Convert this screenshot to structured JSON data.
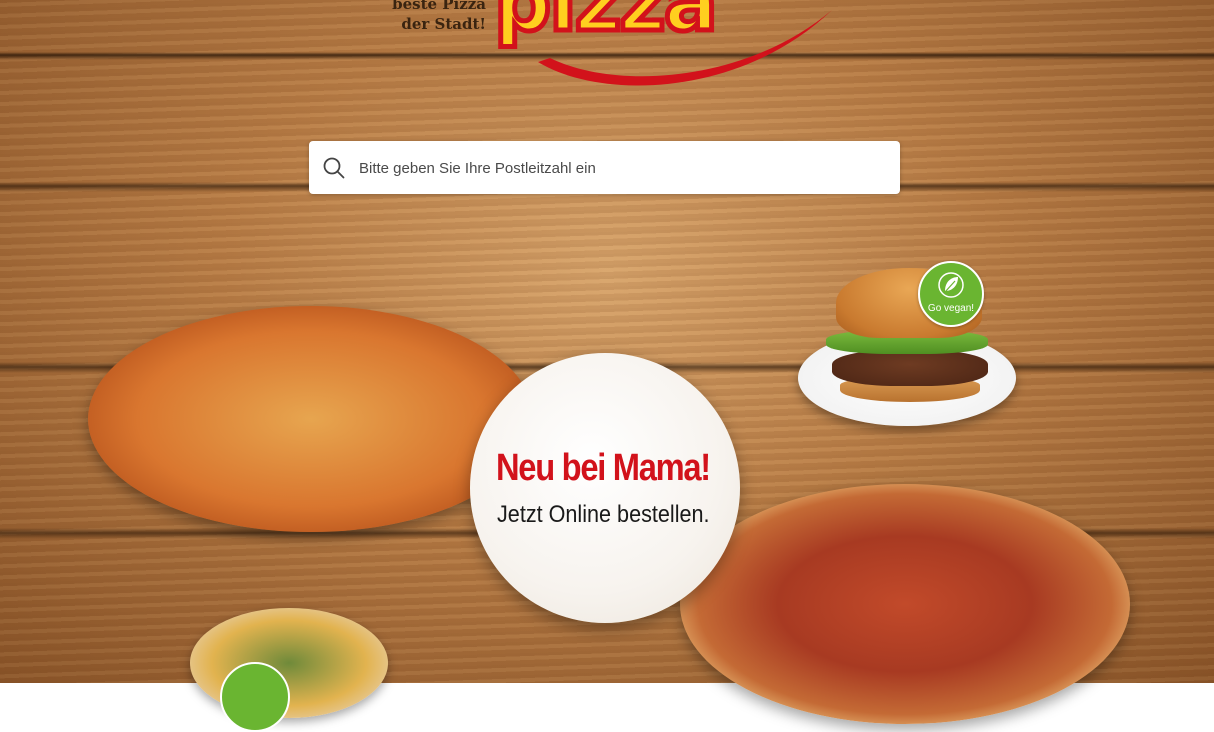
{
  "logo": {
    "tagline_line1": "beste Pizza",
    "tagline_line2": "der Stadt!",
    "wordmark": "pizza",
    "colors": {
      "fill": "#ffcf1f",
      "stroke": "#d2121b"
    }
  },
  "search": {
    "placeholder": "Bitte geben Sie Ihre Postleitzahl ein",
    "value": ""
  },
  "promo": {
    "title": "Neu bei Mama!",
    "subtitle": "Jetzt Online bestellen.",
    "title_color": "#d2121b"
  },
  "badges": {
    "vegan_label": "Go vegan!",
    "vegan_color": "#6ab531"
  },
  "icons": {
    "search": "search-icon",
    "leaf": "leaf-icon"
  }
}
